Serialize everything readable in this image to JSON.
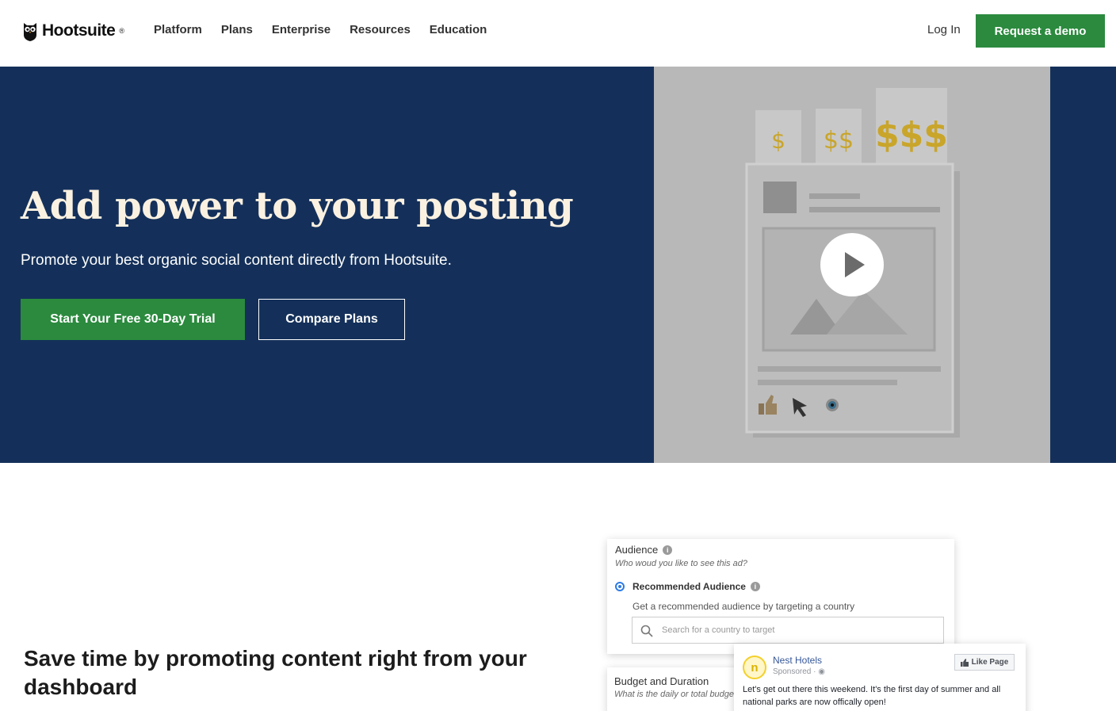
{
  "nav": {
    "brand": "Hootsuite",
    "brand_mark": "®",
    "links": [
      "Platform",
      "Plans",
      "Enterprise",
      "Resources",
      "Education"
    ],
    "login": "Log In",
    "demo": "Request a demo",
    "brand_color": "#2b8a3e"
  },
  "hero": {
    "title": "Add power to your posting",
    "subtitle": "Promote your best organic social content directly from Hootsuite.",
    "primary_cta": "Start Your Free 30-Day Trial",
    "secondary_cta": "Compare Plans",
    "background": "#14305a",
    "video": {
      "price_tags": [
        "$",
        "$$",
        "$$$"
      ],
      "icons": [
        "thumbs-up-icon",
        "cursor-arrow-icon",
        "eye-icon",
        "play-icon"
      ]
    }
  },
  "section2": {
    "title": "Save time by promoting content right from your dashboard",
    "audience": {
      "title": "Audience",
      "question": "Who woud you like to see this ad?",
      "option": "Recommended Audience",
      "option_desc": "Get a recommended audience by targeting a country",
      "search_placeholder": "Search for a country to target"
    },
    "budget": {
      "title": "Budget and Duration",
      "question": "What is the daily or total budget"
    },
    "ad": {
      "avatar_letter": "n",
      "page_name": "Nest Hotels",
      "sponsored": "Sponsored · ",
      "like_button": "Like Page",
      "text": "Let's get out there this weekend. It's the first day of summer and all national parks are now offically open!"
    }
  }
}
